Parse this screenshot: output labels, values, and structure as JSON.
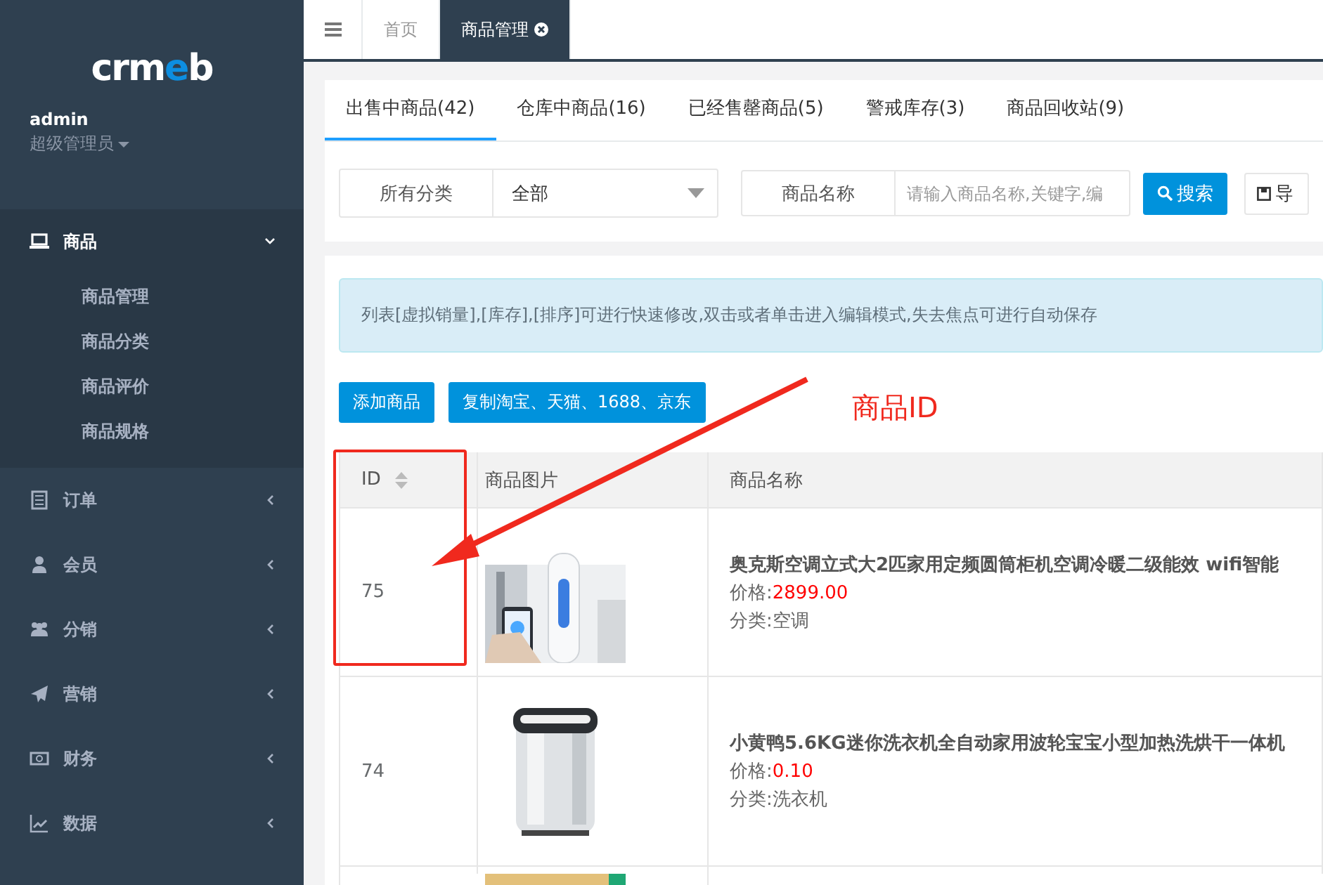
{
  "sidebar": {
    "logo": "crmeb",
    "user": {
      "name": "admin",
      "role": "超级管理员"
    },
    "menu": [
      {
        "label": "商品",
        "expanded": true,
        "children": [
          {
            "label": "商品管理"
          },
          {
            "label": "商品分类"
          },
          {
            "label": "商品评价"
          },
          {
            "label": "商品规格"
          }
        ]
      },
      {
        "label": "订单",
        "expanded": false
      },
      {
        "label": "会员",
        "expanded": false
      },
      {
        "label": "分销",
        "expanded": false
      },
      {
        "label": "营销",
        "expanded": false
      },
      {
        "label": "财务",
        "expanded": false
      },
      {
        "label": "数据",
        "expanded": false
      }
    ]
  },
  "page_tabs": [
    {
      "label": "首页",
      "selected": false,
      "closable": false
    },
    {
      "label": "商品管理",
      "selected": true,
      "closable": true
    }
  ],
  "status_tabs": [
    {
      "label": "出售中商品(42)",
      "selected": true
    },
    {
      "label": "仓库中商品(16)",
      "selected": false
    },
    {
      "label": "已经售罄商品(5)",
      "selected": false
    },
    {
      "label": "警戒库存(3)",
      "selected": false
    },
    {
      "label": "商品回收站(9)",
      "selected": false
    }
  ],
  "filters": {
    "category_label": "所有分类",
    "category_value": "全部",
    "name_label": "商品名称",
    "name_placeholder": "请输入商品名称,关键字,编",
    "search_button": "搜索",
    "export_button": "导"
  },
  "notice": "列表[虚拟销量],[库存],[排序]可进行快速修改,双击或者单击进入编辑模式,失去焦点可进行自动保存",
  "actions": [
    "添加商品",
    "复制淘宝、天猫、1688、京东"
  ],
  "table": {
    "columns": [
      "ID",
      "商品图片",
      "商品名称"
    ],
    "rows": [
      {
        "kind": "product",
        "id": "75",
        "name": "奥克斯空调立式大2匹家用定频圆筒柜机空调冷暖二级能效 wifi智能",
        "price_label": "价格:",
        "price": "2899.00",
        "category": "分类:空调"
      },
      {
        "kind": "product",
        "id": "74",
        "name": "小黄鸭5.6KG迷你洗衣机全自动家用波轮宝宝小型加热洗烘干一体机",
        "price_label": "价格:",
        "price": "0.10",
        "category": "分类:洗衣机"
      },
      {
        "kind": "partial"
      }
    ]
  },
  "annotation": {
    "label": "商品ID"
  }
}
